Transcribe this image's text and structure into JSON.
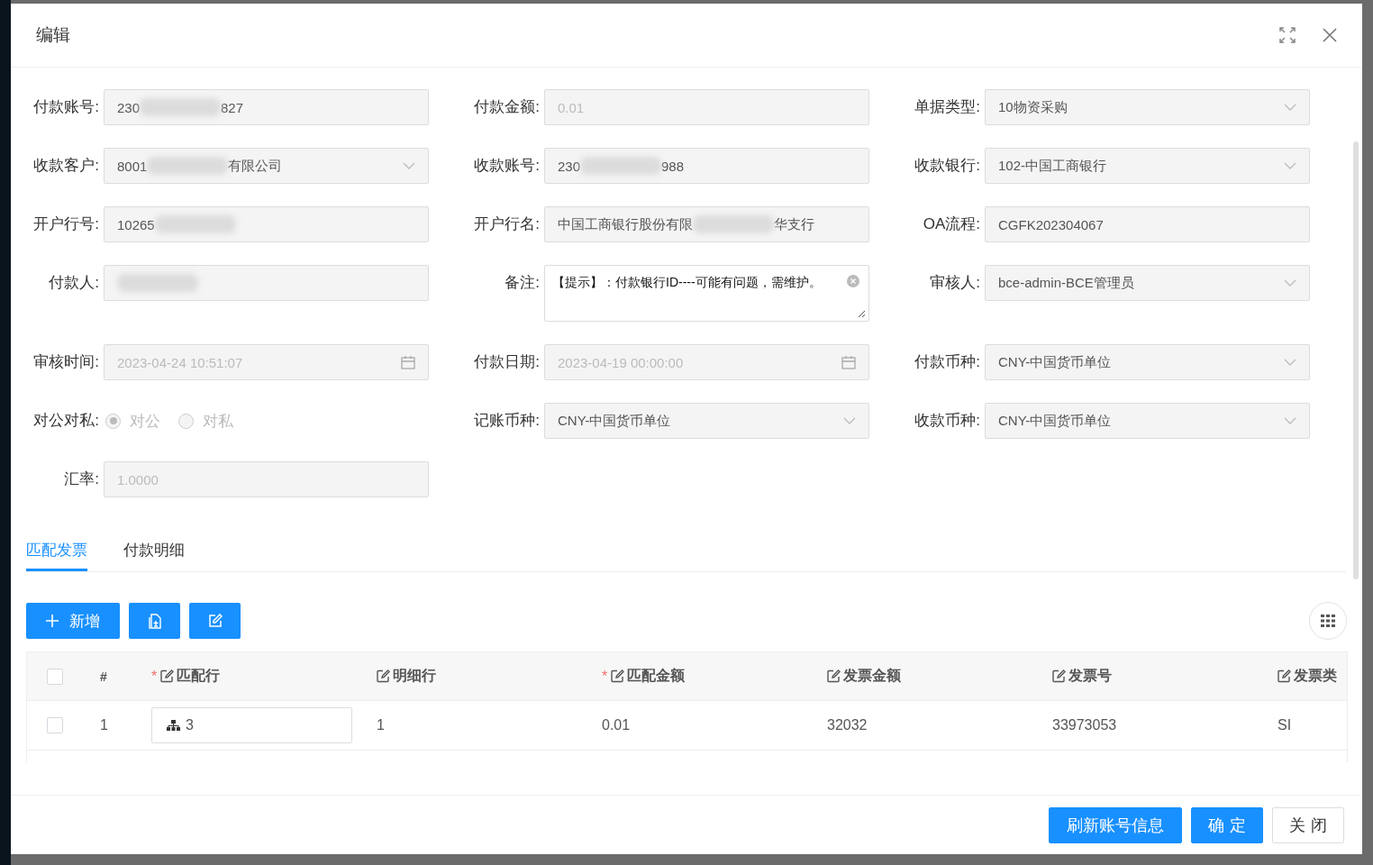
{
  "dialog": {
    "title": "编辑"
  },
  "form": {
    "fields": [
      {
        "label": "付款账号:",
        "kind": "text",
        "disabled": false,
        "segments": [
          {
            "kind": "text",
            "text": "230"
          },
          {
            "kind": "blur"
          },
          {
            "kind": "text",
            "text": "827"
          }
        ]
      },
      {
        "label": "付款金额:",
        "kind": "text",
        "disabled": true,
        "segments": [
          {
            "kind": "text",
            "text": "0.01"
          }
        ]
      },
      {
        "label": "单据类型:",
        "kind": "select",
        "disabled": false,
        "segments": [
          {
            "kind": "text",
            "text": "10物资采购"
          }
        ]
      },
      {
        "label": "收款客户:",
        "kind": "select",
        "disabled": false,
        "segments": [
          {
            "kind": "text",
            "text": "8001"
          },
          {
            "kind": "blur"
          },
          {
            "kind": "text",
            "text": "有限公司"
          }
        ]
      },
      {
        "label": "收款账号:",
        "kind": "text",
        "disabled": false,
        "segments": [
          {
            "kind": "text",
            "text": "230"
          },
          {
            "kind": "blur"
          },
          {
            "kind": "text",
            "text": "988"
          }
        ]
      },
      {
        "label": "收款银行:",
        "kind": "select",
        "disabled": false,
        "segments": [
          {
            "kind": "text",
            "text": "102-中国工商银行"
          }
        ]
      },
      {
        "label": "开户行号:",
        "kind": "text",
        "disabled": false,
        "segments": [
          {
            "kind": "text",
            "text": "10265"
          },
          {
            "kind": "blur"
          }
        ]
      },
      {
        "label": "开户行名:",
        "kind": "text",
        "disabled": false,
        "segments": [
          {
            "kind": "text",
            "text": "中国工商银行股份有限"
          },
          {
            "kind": "blur"
          },
          {
            "kind": "text",
            "text": "华支行"
          }
        ]
      },
      {
        "label": "OA流程:",
        "kind": "text",
        "disabled": false,
        "segments": [
          {
            "kind": "text",
            "text": "CGFK202304067"
          }
        ]
      },
      {
        "label": "付款人:",
        "kind": "text",
        "disabled": false,
        "segments": [
          {
            "kind": "blur"
          }
        ]
      },
      {
        "label": "备注:",
        "kind": "textarea",
        "disabled": false,
        "segments": [
          {
            "kind": "text",
            "text": "【提示】：付款银行ID----可能有问题，需维护。"
          }
        ]
      },
      {
        "label": "审核人:",
        "kind": "select",
        "disabled": false,
        "segments": [
          {
            "kind": "text",
            "text": "bce-admin-BCE管理员"
          }
        ]
      },
      {
        "label": "审核时间:",
        "kind": "date",
        "disabled": true,
        "segments": [
          {
            "kind": "text",
            "text": "2023-04-24 10:51:07"
          }
        ]
      },
      {
        "label": "付款日期:",
        "kind": "date",
        "disabled": true,
        "segments": [
          {
            "kind": "text",
            "text": "2023-04-19 00:00:00"
          }
        ]
      },
      {
        "label": "付款币种:",
        "kind": "select",
        "disabled": false,
        "segments": [
          {
            "kind": "text",
            "text": "CNY-中国货币单位"
          }
        ]
      },
      {
        "label": "对公对私:",
        "kind": "radio",
        "disabled": true,
        "options": [
          {
            "label": "对公",
            "selected": true
          },
          {
            "label": "对私",
            "selected": false
          }
        ]
      },
      {
        "label": "记账币种:",
        "kind": "select",
        "disabled": false,
        "segments": [
          {
            "kind": "text",
            "text": "CNY-中国货币单位"
          }
        ]
      },
      {
        "label": "收款币种:",
        "kind": "select",
        "disabled": false,
        "segments": [
          {
            "kind": "text",
            "text": "CNY-中国货币单位"
          }
        ]
      },
      {
        "label": "汇率:",
        "kind": "text",
        "disabled": true,
        "segments": [
          {
            "kind": "text",
            "text": "1.0000"
          }
        ]
      }
    ]
  },
  "tabs": [
    {
      "label": "匹配发票",
      "selected": true
    },
    {
      "label": "付款明细",
      "selected": false
    }
  ],
  "toolbar": [
    {
      "kind": "add",
      "label": "新增"
    },
    {
      "kind": "file"
    },
    {
      "kind": "edit"
    }
  ],
  "table": {
    "header_checked": false,
    "columns": [
      {
        "label": "#",
        "editable": false
      },
      {
        "required_mark": "*",
        "label": "匹配行",
        "editable": true
      },
      {
        "label": "明细行",
        "editable": true
      },
      {
        "required_mark": "*",
        "label": "匹配金额",
        "editable": true
      },
      {
        "label": "发票金额",
        "editable": true
      },
      {
        "label": "发票号",
        "editable": true
      },
      {
        "label": "发票类",
        "editable": true
      }
    ],
    "rows": [
      {
        "checked": false,
        "cells": [
          "1",
          "3",
          "1",
          "0.01",
          "32032",
          "33973053",
          "SI"
        ]
      }
    ]
  },
  "footer": {
    "buttons": [
      {
        "label": "刷新账号信息",
        "kind": "primary"
      },
      {
        "label": "确定",
        "kind": "primary"
      },
      {
        "label": "关闭",
        "kind": "default"
      }
    ]
  }
}
